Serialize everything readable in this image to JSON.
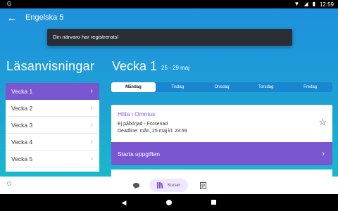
{
  "status_bar": {
    "notification_text": "G",
    "time": "12:59"
  },
  "app_bar": {
    "title": "Engelska 5"
  },
  "snackbar": {
    "message": "Din närvaro har registrerats!"
  },
  "sidebar": {
    "title": "Läsanvisningar",
    "weeks": [
      {
        "label": "Vecka 1",
        "active": true
      },
      {
        "label": "Vecka 2",
        "active": false
      },
      {
        "label": "Vecka 3",
        "active": false
      },
      {
        "label": "Vecka 4",
        "active": false
      },
      {
        "label": "Vecka 5",
        "active": false
      }
    ]
  },
  "main": {
    "week_title": "Vecka 1",
    "date_range": "25 - 29 maj",
    "days": [
      {
        "label": "Måndag",
        "active": true
      },
      {
        "label": "Tisdag",
        "active": false
      },
      {
        "label": "Onsdag",
        "active": false
      },
      {
        "label": "Torsdag",
        "active": false
      },
      {
        "label": "Fredag",
        "active": false
      }
    ],
    "assignment": {
      "link_text": "Hitta i Omnius",
      "status": "Ej påbörjad - Försenad",
      "deadline": "Deadline: mån, 25 maj kl. 23:59",
      "start_label": "Starta uppgiften"
    }
  },
  "bottom_nav": {
    "courses_label": "Kurser",
    "active_item": "Kurser"
  },
  "colors": {
    "accent_purple": "#7a57d1",
    "background_top": "#1f8fde",
    "background_bottom": "#17c3c6",
    "snackbar": "#2a2d33"
  },
  "icons": [
    "back-arrow",
    "star-outline",
    "chevron-right",
    "chat-bubble",
    "library-books",
    "notes",
    "android-back",
    "android-home",
    "android-recents"
  ]
}
